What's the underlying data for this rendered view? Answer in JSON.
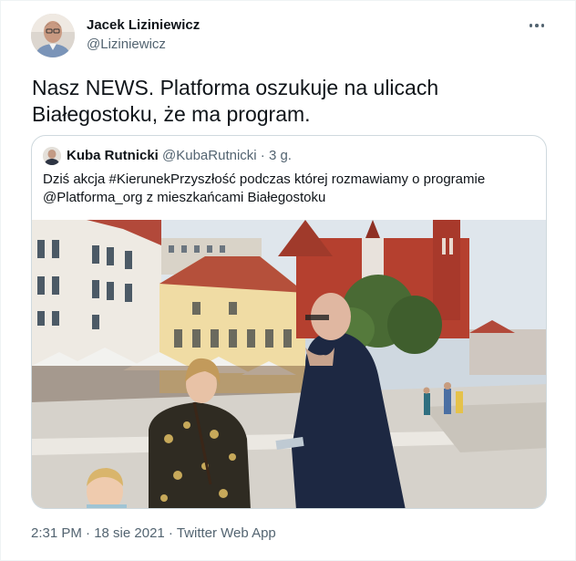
{
  "tweet": {
    "author_name": "Jacek Liziniewicz",
    "author_handle": "@Liziniewicz",
    "text_line1": "Nasz NEWS. Platforma oszukuje na ulicach",
    "text_line2": "Białegostoku, że ma program.",
    "timestamp": "2:31 PM · 18 sie 2021 · Twitter Web App"
  },
  "quoted_tweet": {
    "author_name": "Kuba Rutnicki",
    "author_handle": "@KubaRutnicki",
    "age": "· 3 g.",
    "text_line1": "Dziś akcja #KierunekPrzyszłość podczas której rozmawiamy o programie",
    "text_line2": "@Platforma_org  z mieszkańcami Białegostoku"
  },
  "icons": {
    "more": "more-options-icon"
  },
  "colors": {
    "primary_text": "#0f1419",
    "secondary_text": "#536471",
    "border": "#cfd9de"
  }
}
